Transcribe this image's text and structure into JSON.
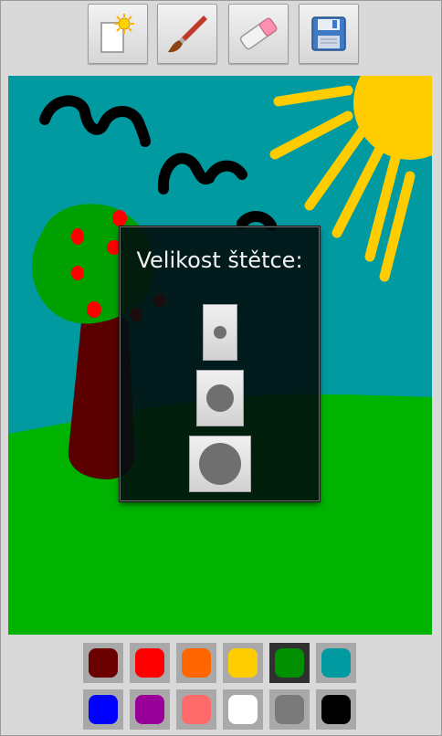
{
  "toolbar": {
    "buttons": [
      {
        "name": "new-canvas-button",
        "icon": "new-page-icon"
      },
      {
        "name": "brush-button",
        "icon": "brush-icon"
      },
      {
        "name": "eraser-button",
        "icon": "eraser-icon"
      },
      {
        "name": "save-button",
        "icon": "floppy-disk-icon"
      }
    ]
  },
  "dialog": {
    "title": "Velikost štětce:",
    "sizes": [
      "small",
      "medium",
      "large"
    ]
  },
  "palette": {
    "selected": "#008f00",
    "colors": [
      "#6b0000",
      "#ff0000",
      "#ff6600",
      "#ffcc00",
      "#008f00",
      "#009aa0",
      "#0000ff",
      "#990099",
      "#ff6b6b",
      "#ffffff",
      "#7a7a7a",
      "#000000"
    ]
  },
  "drawing": {
    "sky_color": "#009aa0",
    "grass_color": "#00b300",
    "sun_color": "#ffcc00",
    "trunk_color": "#5a0000",
    "crown_color": "#00a000",
    "apple_color": "#ff0000",
    "bird_color": "#000000"
  }
}
